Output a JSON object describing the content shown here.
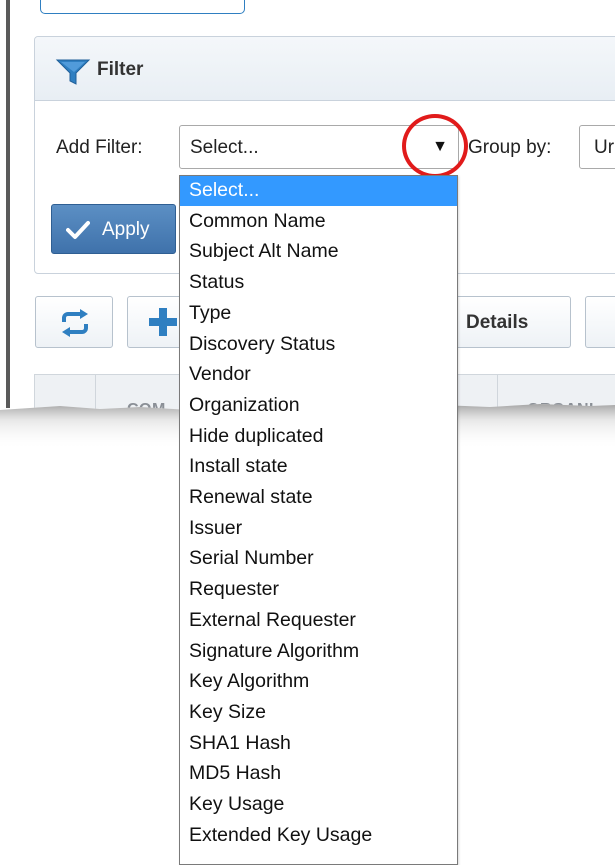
{
  "filter": {
    "title": "Filter",
    "add_filter_label": "Add Filter:",
    "select_value": "Select...",
    "group_by_label": "Group by:",
    "group_by_value": "Ur",
    "apply_label": "Apply"
  },
  "toolbar": {
    "details_label": "Details"
  },
  "table": {
    "columns": [
      "COM",
      "ORGANI"
    ]
  },
  "dropdown": {
    "selected_index": 0,
    "options": [
      "Select...",
      "Common Name",
      "Subject Alt Name",
      "Status",
      "Type",
      "Discovery Status",
      "Vendor",
      "Organization",
      "Hide duplicated",
      "Install state",
      "Renewal state",
      "Issuer",
      "Serial Number",
      "Requester",
      "External Requester",
      "Signature Algorithm",
      "Key Algorithm",
      "Key Size",
      "SHA1 Hash",
      "MD5 Hash",
      "Key Usage",
      "Extended Key Usage"
    ]
  },
  "colors": {
    "accent": "#3f72ab",
    "selected_option_bg": "#3399ff",
    "highlight_circle": "#e11b1b"
  }
}
